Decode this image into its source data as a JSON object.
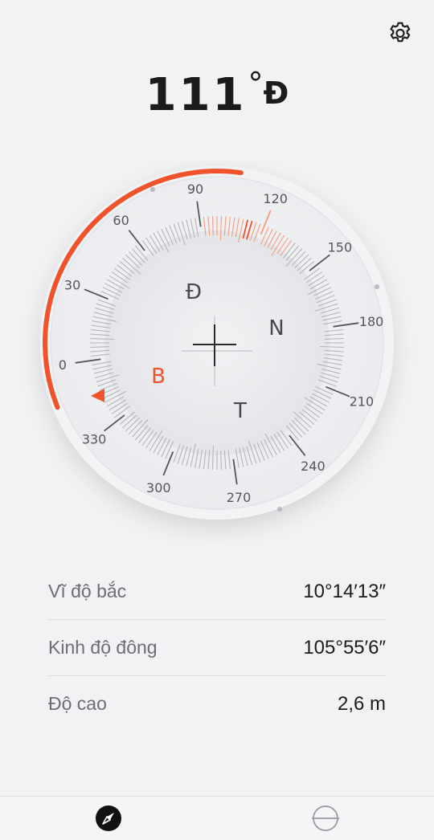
{
  "heading": {
    "value": "111",
    "degree_symbol": "°",
    "direction": "Đ"
  },
  "compass": {
    "heading_degrees": 111,
    "accent_color": "#f0532b",
    "marker_label": "0",
    "bearing_labels": [
      "0",
      "30",
      "60",
      "90",
      "120",
      "150",
      "180",
      "210",
      "240",
      "270",
      "300",
      "330"
    ],
    "cardinals": {
      "east": "Đ",
      "north": "N",
      "west": "B",
      "south": "T"
    }
  },
  "info": {
    "latitude": {
      "label": "Vĩ độ bắc",
      "value": "10°14′13″"
    },
    "longitude": {
      "label": "Kinh độ đông",
      "value": "105°55′6″"
    },
    "altitude": {
      "label": "Độ cao",
      "value": "2,6 m"
    }
  },
  "tabs": [
    {
      "icon": "compass-icon",
      "active": true
    },
    {
      "icon": "level-icon",
      "active": false
    }
  ]
}
